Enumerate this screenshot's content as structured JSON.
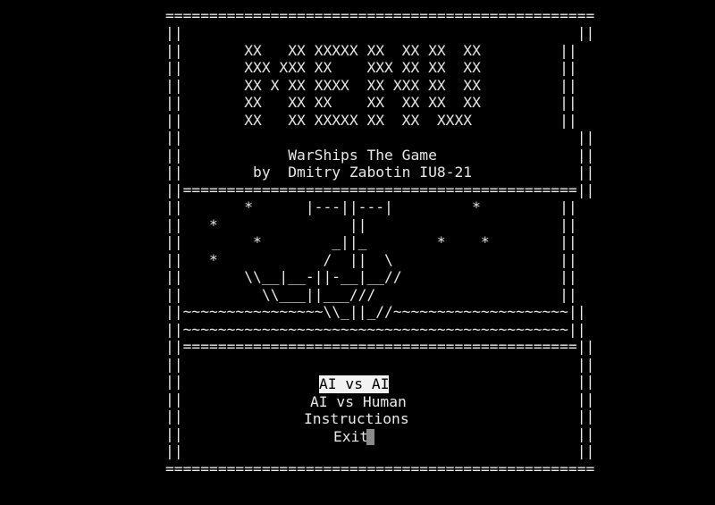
{
  "border": {
    "top": "=================================================",
    "bottom": "=================================================",
    "side_empty": "||                                             ||",
    "separator": "||=============================================||"
  },
  "logo": {
    "lines": [
      "||       XX   XX XXXXX XX  XX XX  XX         ||",
      "||       XXX XXX XX    XXX XX XX  XX         ||",
      "||       XX X XX XXXX  XX XXX XX  XX         ||",
      "||       XX   XX XX    XX  XX XX  XX         ||",
      "||       XX   XX XXXXX XX  XX  XXXX          ||"
    ]
  },
  "title": {
    "line1": "||            WarShips The Game                ||",
    "line2": "||        by  Dmitry Zabotin IU8-21            ||"
  },
  "ship": {
    "lines": [
      "||       *      |---||---|         *         ||",
      "||   *               ||                      ||",
      "||        *        _||_        *    *        ||",
      "||   *            /  ||  \\                   ||",
      "||       \\\\__|__-||-__|__//                  ||",
      "||         \\\\___||___///                     ||",
      "||~~~~~~~~~~~~~~~~\\\\_||_//~~~~~~~~~~~~~~~~~~~~||",
      "||~~~~~~~~~~~~~~~~~~~~~~~~~~~~~~~~~~~~~~~~~~~~||"
    ]
  },
  "menu": {
    "items": [
      {
        "label": "AI vs AI",
        "selected": true
      },
      {
        "label": "AI vs Human",
        "selected": false
      },
      {
        "label": "Instructions",
        "selected": false
      },
      {
        "label": "Exit",
        "selected": false
      }
    ]
  }
}
